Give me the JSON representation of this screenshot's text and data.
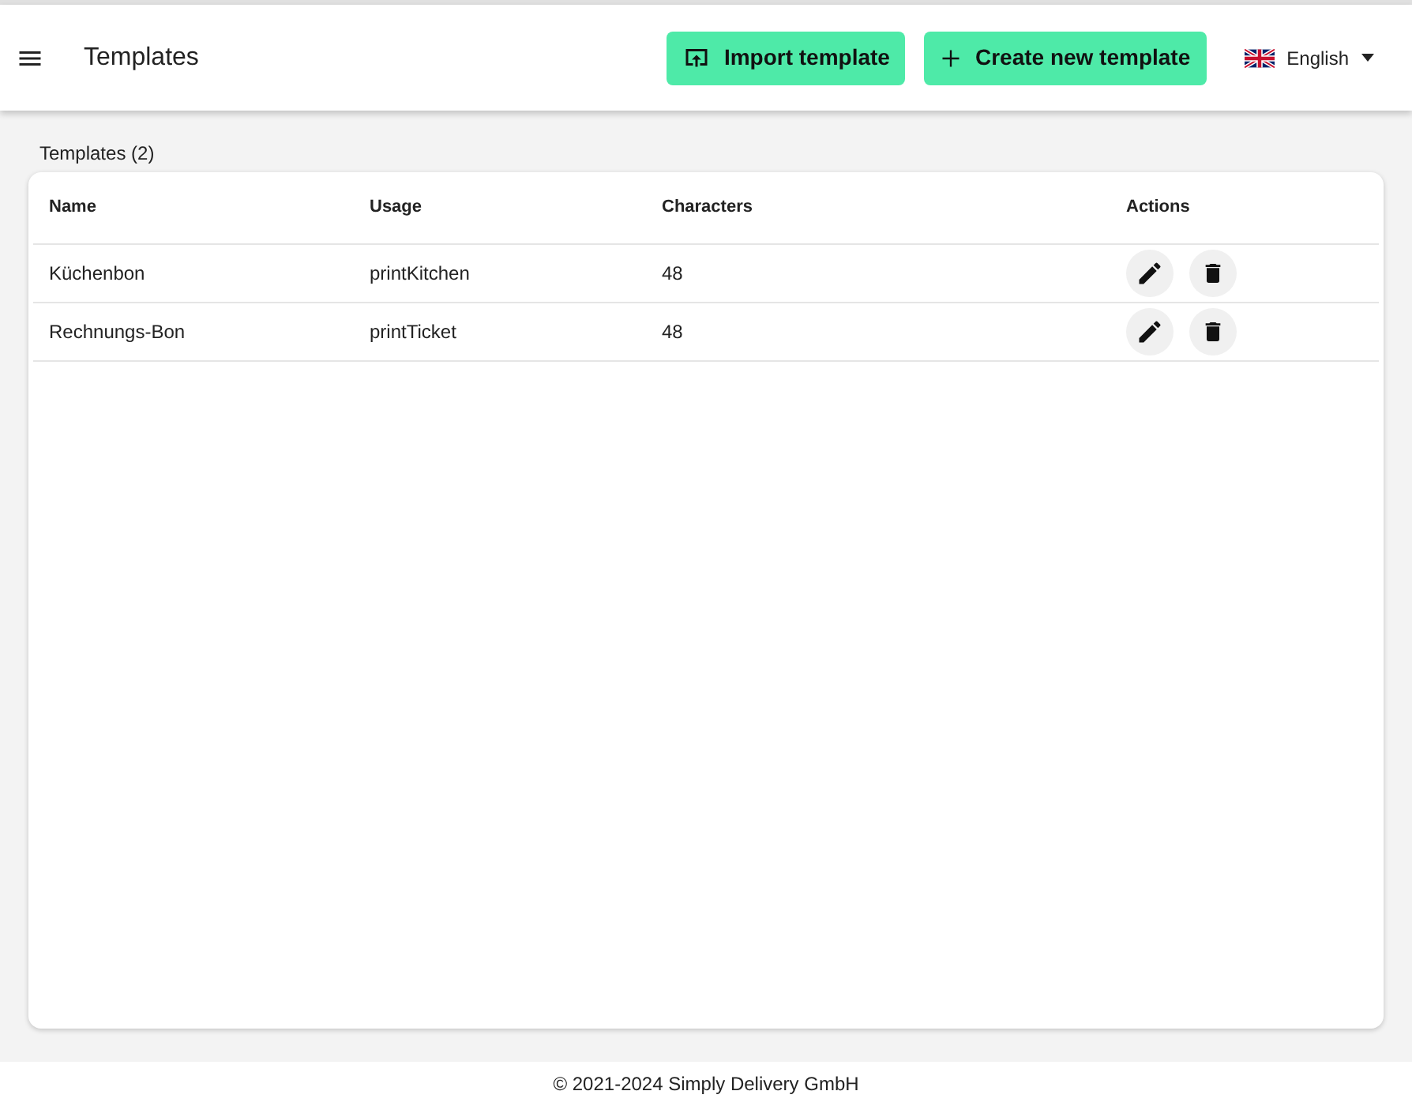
{
  "header": {
    "title": "Templates",
    "buttons": [
      {
        "label": "Import template",
        "kind": "import"
      },
      {
        "label": "Create new template",
        "kind": "create"
      }
    ],
    "language": "English"
  },
  "section_label": "Templates (2)",
  "table": {
    "columns": [
      "Name",
      "Usage",
      "Characters",
      "Actions"
    ],
    "rows": [
      {
        "name": "Küchenbon",
        "usage": "printKitchen",
        "characters": "48"
      },
      {
        "name": "Rechnungs-Bon",
        "usage": "printTicket",
        "characters": "48"
      }
    ]
  },
  "footer": "© 2021-2024 Simply Delivery GmbH"
}
